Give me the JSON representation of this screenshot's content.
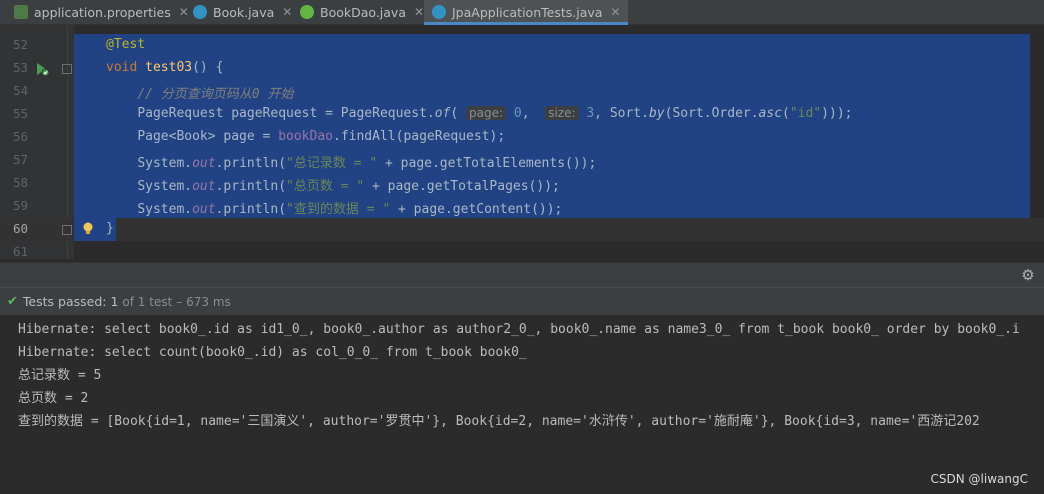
{
  "tabs": [
    {
      "label": "application.properties",
      "icon": "properties-file-icon",
      "icon_color": "#6a8759"
    },
    {
      "label": "Book.java",
      "icon": "java-class-icon",
      "icon_color": "#3592c4"
    },
    {
      "label": "BookDao.java",
      "icon": "java-interface-icon",
      "icon_color": "#62b543"
    },
    {
      "label": "JpaApplicationTests.java",
      "icon": "java-test-class-icon",
      "icon_color": "#3592c4",
      "active": true
    }
  ],
  "editor": {
    "line_numbers": [
      "52",
      "53",
      "54",
      "55",
      "56",
      "57",
      "58",
      "59",
      "60",
      "61"
    ],
    "lines": {
      "l52_annotation": "@Test",
      "l53_kw": "void",
      "l53_name": "test03",
      "l53_rest": "() {",
      "l54_comment": "// 分页查询页码从0 开始",
      "l55_a": "PageRequest pageRequest = PageRequest.",
      "l55_of": "of",
      "l55_b": "(",
      "l55_hint1": "page:",
      "l55_num1": "0",
      "l55_c": ", ",
      "l55_hint2": "size:",
      "l55_num2": "3",
      "l55_d": ", Sort.",
      "l55_by": "by",
      "l55_e": "(Sort.Order.",
      "l55_asc": "asc",
      "l55_f": "(",
      "l55_str": "\"id\"",
      "l55_g": ")));",
      "l56_a": "Page<Book> page = ",
      "l56_field": "bookDao",
      "l56_b": ".findAll(pageRequest);",
      "sys": "System.",
      "out": "out",
      "println": ".println(",
      "l57_str": "\"总记录数 = \"",
      "l57_rest": " + page.getTotalElements());",
      "l58_str": "\"总页数 = \"",
      "l58_rest": " + page.getTotalPages());",
      "l59_str": "\"查到的数据 = \"",
      "l59_rest": " + page.getContent());",
      "l60_brace": "}"
    }
  },
  "tests": {
    "status": "Tests passed:",
    "count": "1",
    "total": "of 1 test",
    "time": "– 673 ms"
  },
  "console": [
    "Hibernate: select book0_.id as id1_0_, book0_.author as author2_0_, book0_.name as name3_0_ from t_book book0_ order by book0_.i",
    "Hibernate: select count(book0_.id) as col_0_0_ from t_book book0_",
    "总记录数 = 5",
    "总页数 = 2",
    "查到的数据 = [Book{id=1, name='三国演义', author='罗贯中'}, Book{id=2, name='水浒传', author='施耐庵'}, Book{id=3, name='西游记202"
  ],
  "watermark": "CSDN @liwangC"
}
